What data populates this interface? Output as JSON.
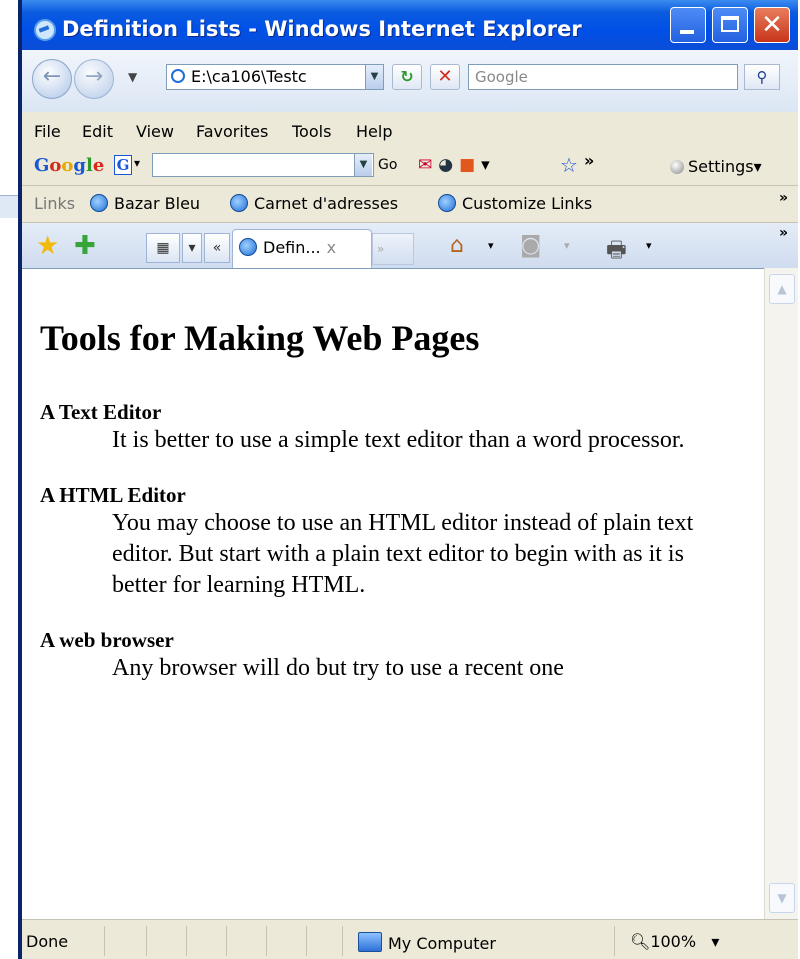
{
  "window": {
    "title": "Definition Lists - Windows Internet Explorer"
  },
  "navbar": {
    "address": "E:\\ca106\\Testc",
    "search_placeholder": "Google"
  },
  "menubar": {
    "items": [
      "File",
      "Edit",
      "View",
      "Favorites",
      "Tools",
      "Help"
    ]
  },
  "google_toolbar": {
    "logo": [
      "G",
      "o",
      "o",
      "g",
      "l",
      "e"
    ],
    "box_letter": "G",
    "go_label": "Go",
    "more": "»",
    "settings_label": "Settings▾"
  },
  "links_bar": {
    "label": "Links",
    "links": [
      "Bazar Bleu",
      "Carnet d'adresses",
      "Customize Links"
    ],
    "chevron": "»"
  },
  "tabs": {
    "active_tab_label": "Defin...",
    "close_label": "x",
    "new_tab_label": "»"
  },
  "page": {
    "heading": "Tools for Making Web Pages",
    "definitions": [
      {
        "term": "A Text Editor",
        "description": "It is better to use a simple text editor than a word processor."
      },
      {
        "term": "A HTML Editor",
        "description": "You may choose to use an HTML editor instead of plain text editor. But start with a plain text editor to begin with as it is better for learning HTML."
      },
      {
        "term": "A web browser",
        "description": "Any browser will do but try to use a recent one"
      }
    ]
  },
  "status_bar": {
    "status": "Done",
    "zone": "My Computer",
    "zoom": "100%"
  }
}
